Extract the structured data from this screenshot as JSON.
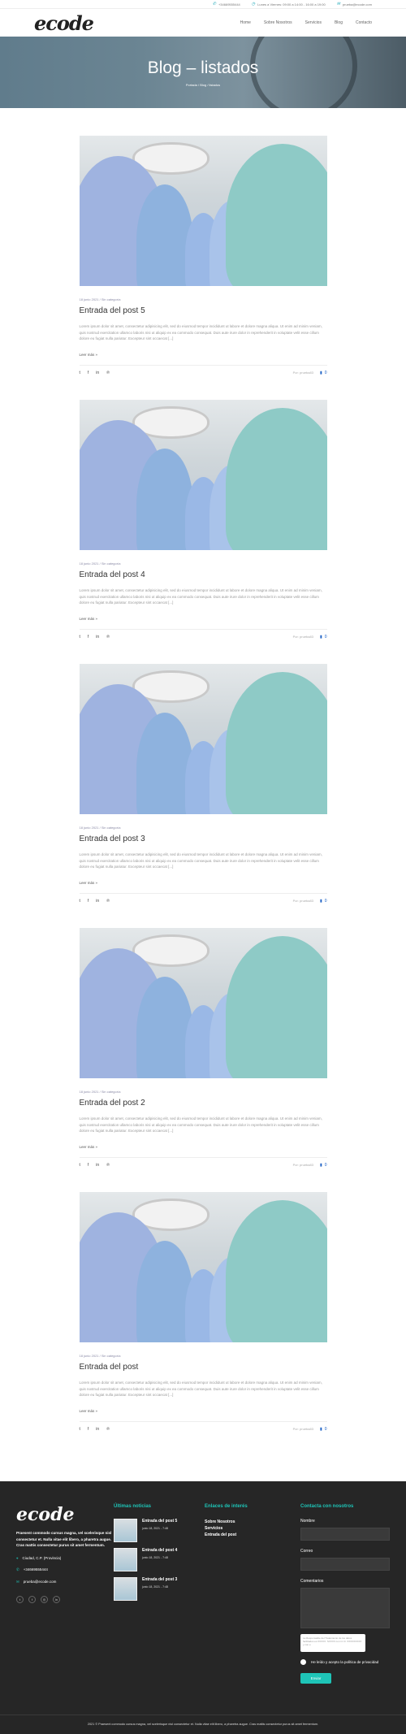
{
  "topbar": {
    "phone": "+34669555444",
    "hours": "Lunes a Viernes: 09:00 a 14:00 - 16:00 a 19:00",
    "email": "prueba@ecode.com"
  },
  "brand": {
    "logo": "ecode"
  },
  "nav": [
    "Home",
    "Sobre Nosotros",
    "Servicios",
    "Blog",
    "Contacto"
  ],
  "hero": {
    "title": "Blog – listados",
    "breadcrumb": "Portada / Blog / listados"
  },
  "posts": [
    {
      "meta": "18 junio 2021 / Sin categoría",
      "title": "Entrada del post 5",
      "excerpt": "Lorem ipsum dolor sit amet, consectetur adipisicing elit, sed do eiusmod tempor incididunt ut labore et dolore magna aliqua. Ut enim ad minim veniam, quis nostrud exercitation ullamco laboris nisi ut aliquip ex ea commodo consequat. Duis aute irure dolor in reprehenderit in voluptate velit esse cillum dolore eu fugiat nulla pariatur. Excepteur sint occaecat [...]",
      "more": "Leer más »",
      "author": "Por: prueba83",
      "comments": "0"
    },
    {
      "meta": "18 junio 2021 / Sin categoría",
      "title": "Entrada del post 4",
      "excerpt": "Lorem ipsum dolor sit amet, consectetur adipisicing elit, sed do eiusmod tempor incididunt ut labore et dolore magna aliqua. Ut enim ad minim veniam, quis nostrud exercitation ullamco laboris nisi ut aliquip ex ea commodo consequat. Duis aute irure dolor in reprehenderit in voluptate velit esse cillum dolore eu fugiat nulla pariatur. Excepteur sint occaecat [...]",
      "more": "Leer más »",
      "author": "Por: prueba83",
      "comments": "0"
    },
    {
      "meta": "18 junio 2021 / Sin categoría",
      "title": "Entrada del post 3",
      "excerpt": "Lorem ipsum dolor sit amet, consectetur adipisicing elit, sed do eiusmod tempor incididunt ut labore et dolore magna aliqua. Ut enim ad minim veniam, quis nostrud exercitation ullamco laboris nisi ut aliquip ex ea commodo consequat. Duis aute irure dolor in reprehenderit in voluptate velit esse cillum dolore eu fugiat nulla pariatur. Excepteur sint occaecat [...]",
      "more": "Leer más »",
      "author": "Por: prueba83",
      "comments": "0"
    },
    {
      "meta": "18 junio 2021 / Sin categoría",
      "title": "Entrada del post 2",
      "excerpt": "Lorem ipsum dolor sit amet, consectetur adipisicing elit, sed do eiusmod tempor incididunt ut labore et dolore magna aliqua. Ut enim ad minim veniam, quis nostrud exercitation ullamco laboris nisi ut aliquip ex ea commodo consequat. Duis aute irure dolor in reprehenderit in voluptate velit esse cillum dolore eu fugiat nulla pariatur. Excepteur sint occaecat [...]",
      "more": "Leer más »",
      "author": "Por: prueba83",
      "comments": "0"
    },
    {
      "meta": "18 junio 2021 / Sin categoría",
      "title": "Entrada del post",
      "excerpt": "Lorem ipsum dolor sit amet, consectetur adipisicing elit, sed do eiusmod tempor incididunt ut labore et dolore magna aliqua. Ut enim ad minim veniam, quis nostrud exercitation ullamco laboris nisi ut aliquip ex ea commodo consequat. Duis aute irure dolor in reprehenderit in voluptate velit esse cillum dolore eu fugiat nulla pariatur. Excepteur sint occaecat [...]",
      "more": "Leer más »",
      "author": "Por: prueba83",
      "comments": "0"
    }
  ],
  "footer": {
    "logo": "ecode",
    "desc": "Praesent commodo cursus magna, vel scelerisque nisl consectetur et. Nulla vitae elit libero, a pharetra augue. Cras mattis consectetur purus sit amet fermentum.",
    "address": "Ciudad, C.P. (Provincia)",
    "phone": "+34669555444",
    "email": "prueba@ecode.com",
    "recent_title": "Últimas noticias",
    "recent": [
      {
        "title": "Entrada del post 5",
        "date": "junio 18, 2021 - 7:48"
      },
      {
        "title": "Entrada del post 4",
        "date": "junio 18, 2021 - 7:48"
      },
      {
        "title": "Entrada del post 3",
        "date": "junio 18, 2021 - 7:48"
      }
    ],
    "links_title": "Enlaces de interés",
    "links": [
      "Sobre Nosotros",
      "Servicios",
      "Entrada del post"
    ],
    "contact_title": "Contacta con nosotros",
    "name_label": "Nombre",
    "mail_label": "Correo",
    "comment_label": "Comentarios",
    "captcha": "La Responsable del Tratamiento de los datos facilitados es XXXXX. SXXXX con C.I.F. XXXXXXXXX y con e",
    "privacy": "He leído y acepto la política de privacidad",
    "submit": "Enviar",
    "copyright": "2021 © Praesent commodo cursus magna, vel scelerisque nisl consectetur et. Nulla vitae elit libero, a pharetra augue. Cras mattis consectetur purus sit amet fermentum."
  }
}
